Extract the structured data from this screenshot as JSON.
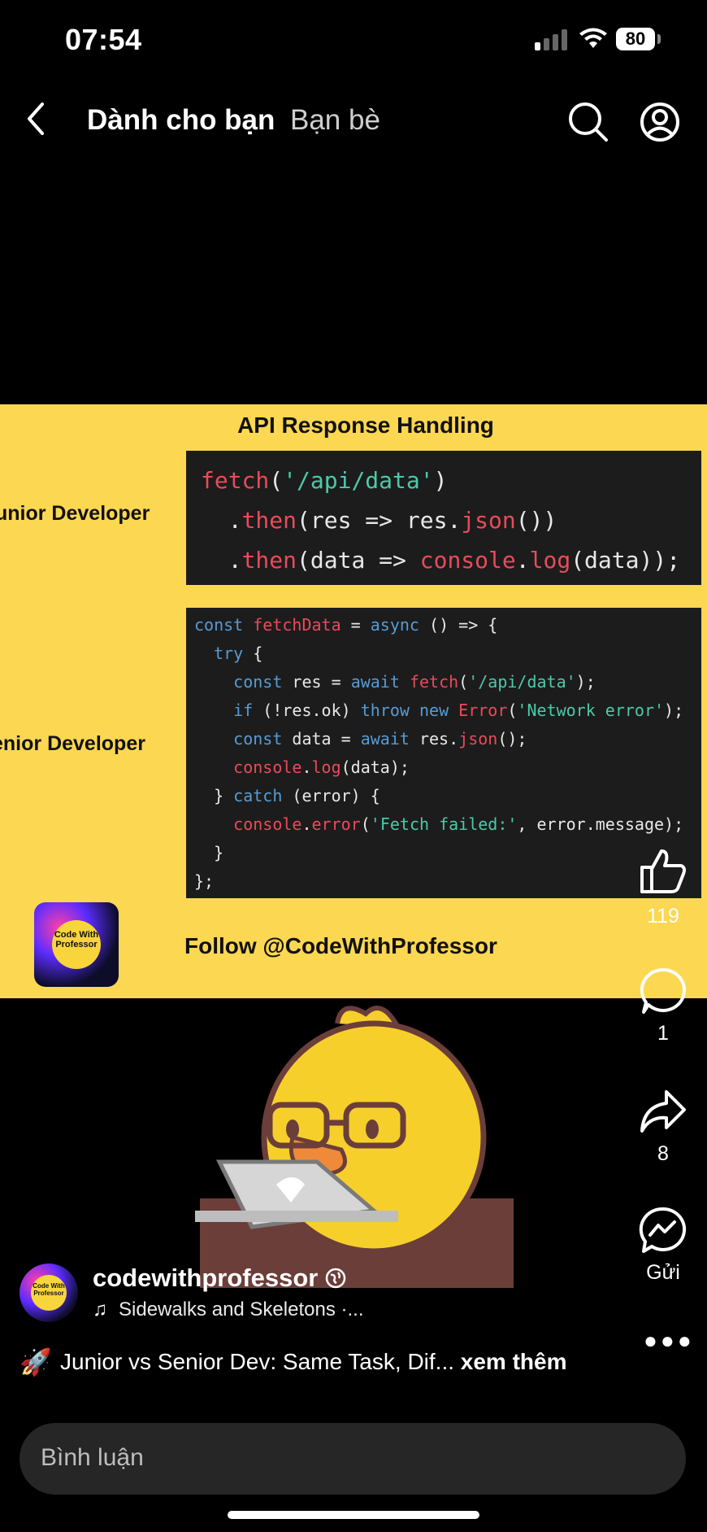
{
  "status_bar": {
    "time": "07:54",
    "battery": "80"
  },
  "nav": {
    "tab_for_you": "Dành cho bạn",
    "tab_friends": "Bạn bè"
  },
  "post": {
    "title": "API Response Handling",
    "junior_label": "unior Developer",
    "senior_label": "enior Developer",
    "junior_code": [
      "fetch('/api/data')",
      "  .then(res => res.json())",
      "  .then(data => console.log(data));"
    ],
    "senior_code": [
      "const fetchData = async () => {",
      "  try {",
      "    const res = await fetch('/api/data');",
      "    if (!res.ok) throw new Error('Network error');",
      "    const data = await res.json();",
      "    console.log(data);",
      "  } catch (error) {",
      "    console.error('Fetch failed:', error.message);",
      "  }",
      "};"
    ],
    "logo_text": "Code With Professor",
    "follow_text": "Follow @CodeWithProfessor"
  },
  "actions": {
    "likes": "119",
    "comments": "1",
    "shares": "8",
    "send_label": "Gửi"
  },
  "author": {
    "username": "codewithprofessor",
    "song": "Sidewalks and Skeletons ·...",
    "avatar_text": "Code With Professor"
  },
  "caption": {
    "text": "Junior vs Senior Dev: Same Task, Dif...",
    "see_more": "xem thêm"
  },
  "comment_input": {
    "placeholder": "Bình luận"
  },
  "icons": [
    "back-icon",
    "search-icon",
    "profile-icon",
    "like-icon",
    "comment-icon",
    "share-icon",
    "messenger-icon",
    "more-icon",
    "music-icon",
    "rocket-icon"
  ]
}
